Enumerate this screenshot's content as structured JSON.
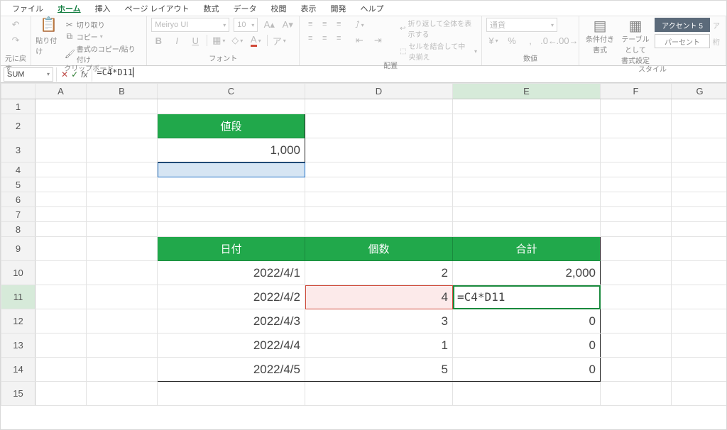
{
  "menu": {
    "tabs": [
      "ファイル",
      "ホーム",
      "挿入",
      "ページ レイアウト",
      "数式",
      "データ",
      "校閲",
      "表示",
      "開発",
      "ヘルプ"
    ],
    "active_index": 1
  },
  "ribbon": {
    "undo": {
      "label": "元に戻す"
    },
    "clipboard": {
      "paste": "貼り付け",
      "cut": "切り取り",
      "copy": "コピー",
      "fmtpaint": "書式のコピー/貼り付け",
      "group": "クリップボード"
    },
    "font": {
      "name": "Meiryo UI",
      "size": "10",
      "group": "フォント"
    },
    "align": {
      "wrap": "折り返して全体を表示する",
      "merge": "セルを結合して中央揃え",
      "group": "配置"
    },
    "number": {
      "fmt": "通貨",
      "group": "数値"
    },
    "styles": {
      "cond": "条件付き\n書式",
      "tablefmt": "テーブルとして\n書式設定",
      "accent": "アクセント 5",
      "percent": "パーセント",
      "group": "スタイル",
      "extra": "ア",
      "extra2": "桁"
    }
  },
  "formula_bar": {
    "namebox": "SUM",
    "formula": "=C4*D11"
  },
  "columns": [
    "A",
    "B",
    "C",
    "D",
    "E",
    "F",
    "G"
  ],
  "sheet": {
    "price_header": "値段",
    "price_value": "1,000",
    "table_headers": {
      "c": "日付",
      "d": "個数",
      "e": "合計"
    },
    "rows": [
      {
        "date": "2022/4/1",
        "qty": "2",
        "total": "2,000"
      },
      {
        "date": "2022/4/2",
        "qty": "4",
        "total": "=C4*D11"
      },
      {
        "date": "2022/4/3",
        "qty": "3",
        "total": "0"
      },
      {
        "date": "2022/4/4",
        "qty": "1",
        "total": "0"
      },
      {
        "date": "2022/4/5",
        "qty": "5",
        "total": "0"
      }
    ],
    "editing_cell": "E11"
  }
}
